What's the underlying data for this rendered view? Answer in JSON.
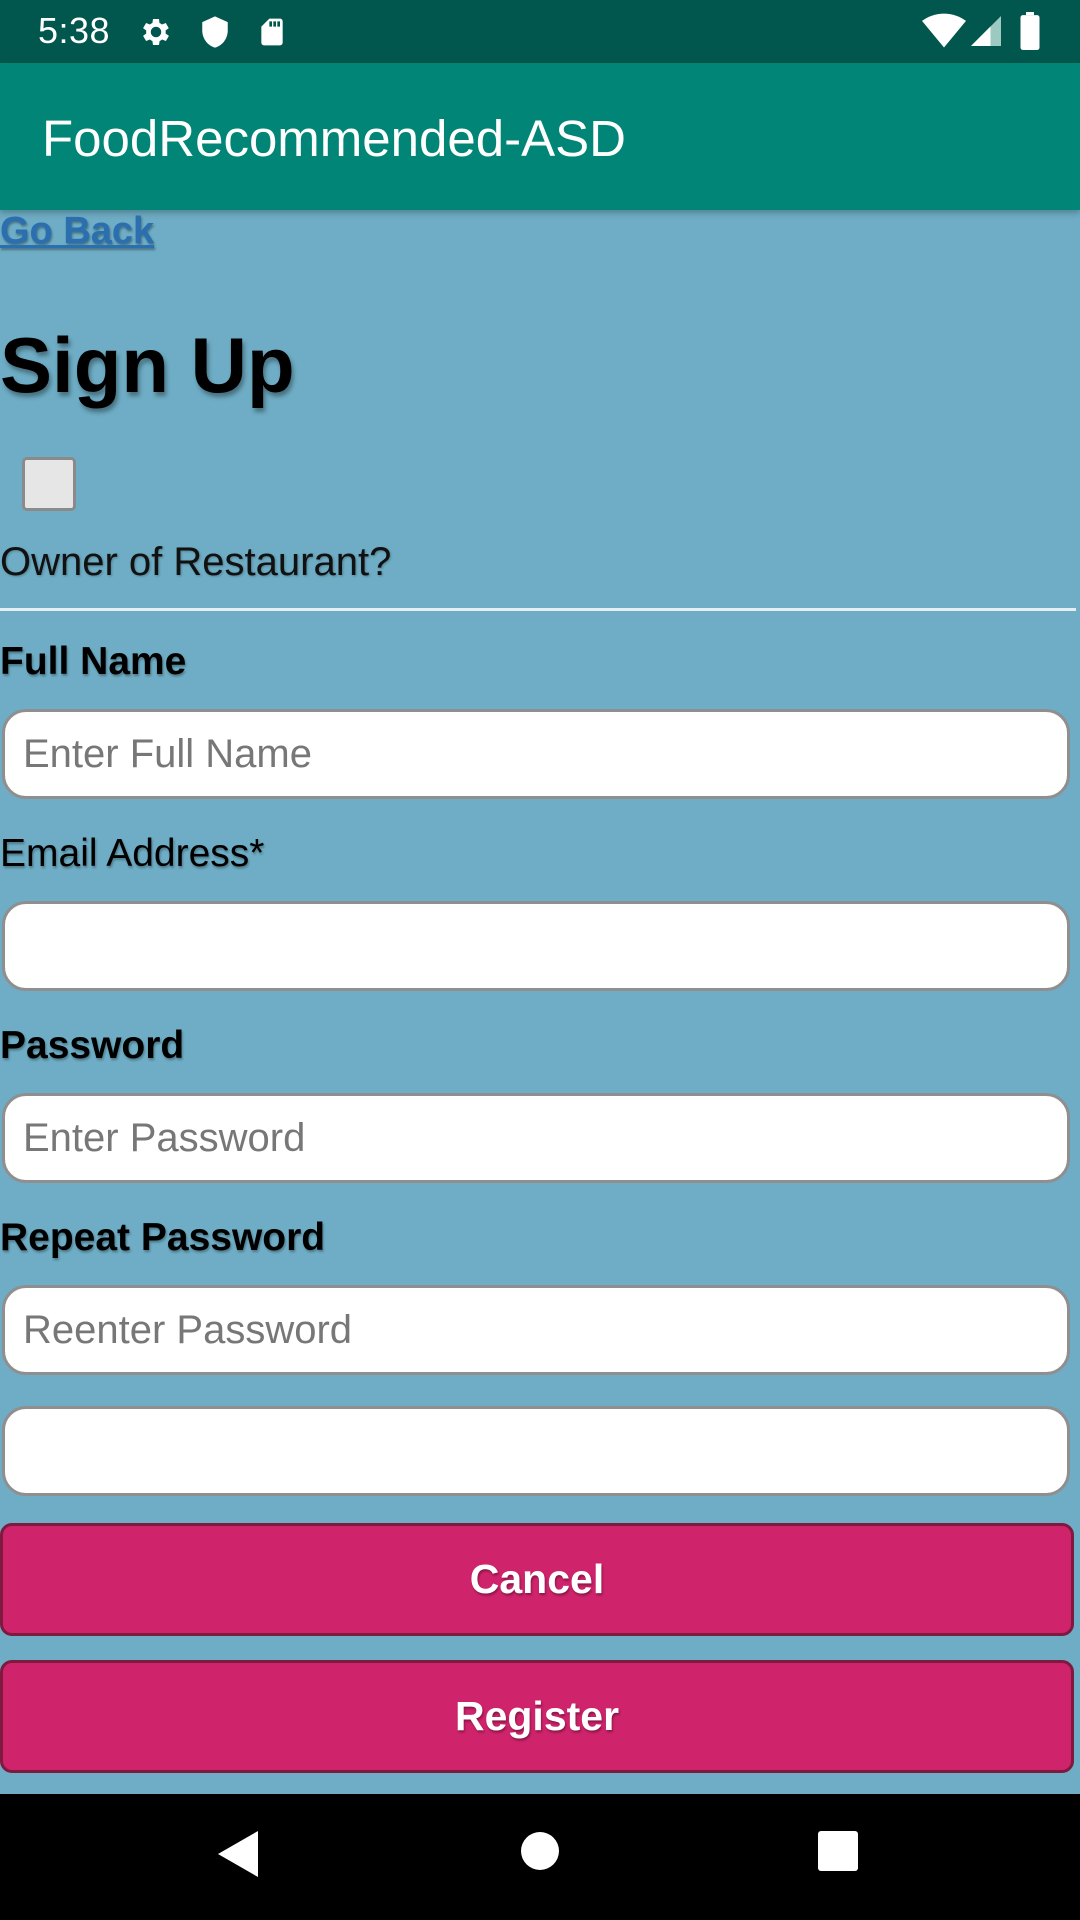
{
  "status_bar": {
    "time": "5:38",
    "icons": [
      "gear-icon",
      "shield-icon",
      "sd-card-icon",
      "wifi-icon",
      "cell-signal-icon",
      "battery-icon"
    ]
  },
  "app_bar": {
    "title": "FoodRecommended-ASD"
  },
  "form": {
    "go_back": "Go Back",
    "heading": "Sign Up",
    "owner_checkbox": {
      "label": "Owner of Restaurant?",
      "checked": false
    },
    "full_name": {
      "label": "Full Name",
      "placeholder": "Enter Full Name",
      "value": ""
    },
    "email": {
      "label": "Email Address*",
      "placeholder": "",
      "value": ""
    },
    "password": {
      "label": "Password",
      "placeholder": "Enter Password",
      "value": ""
    },
    "repeat_password": {
      "label": "Repeat Password",
      "placeholder": "Reenter Password",
      "value": ""
    },
    "extra_field": {
      "placeholder": "",
      "value": ""
    },
    "cancel_label": "Cancel",
    "register_label": "Register"
  },
  "nav_bar": {
    "icons": [
      "back-icon",
      "home-icon",
      "recents-icon"
    ]
  },
  "colors": {
    "status_bar": "#01574d",
    "app_bar": "#018576",
    "page_background": "#6eadc5",
    "button": "#cf236b",
    "link": "#2a6fb0"
  }
}
